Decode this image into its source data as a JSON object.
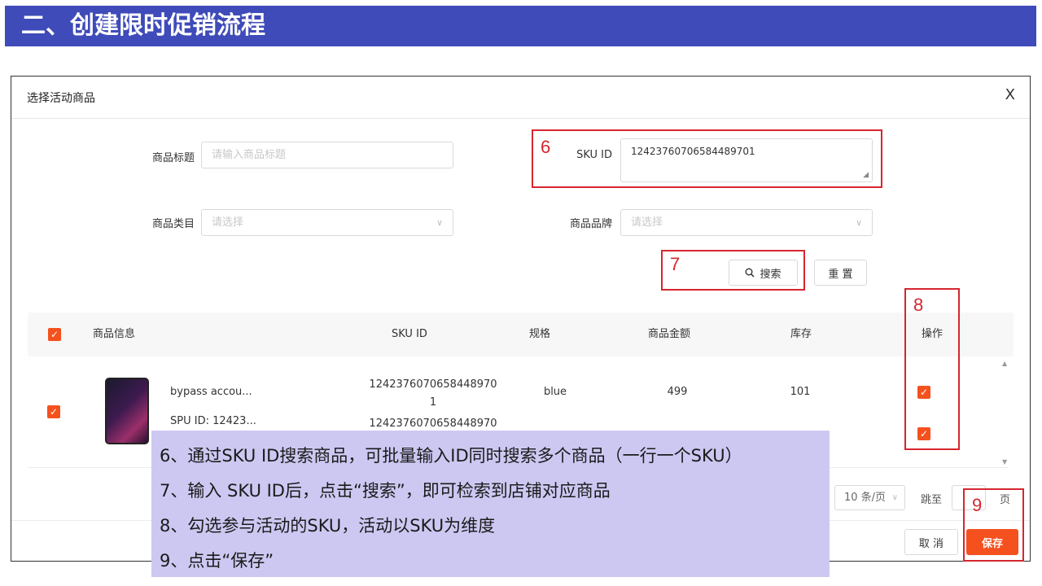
{
  "slide": {
    "title": "二、创建限时促销流程"
  },
  "dialog": {
    "title": "选择活动商品",
    "close": "X"
  },
  "form": {
    "title_label": "商品标题",
    "title_placeholder": "请输入商品标题",
    "sku_label": "SKU ID",
    "sku_value": "1242376070658448970​1",
    "category_label": "商品类目",
    "category_placeholder": "请选择",
    "brand_label": "商品品牌",
    "brand_placeholder": "请选择",
    "search_btn": "搜索",
    "reset_btn": "重 置"
  },
  "steps": {
    "s6": "6",
    "s7": "7",
    "s8": "8",
    "s9": "9"
  },
  "table": {
    "headers": {
      "product": "商品信息",
      "sku": "SKU ID",
      "spec": "规格",
      "price": "商品金额",
      "stock": "库存",
      "action": "操作"
    },
    "product": {
      "name": "bypass accou...",
      "spu": "SPU ID: 12423..."
    },
    "rows": [
      {
        "sku_line1": "1242376070658448970",
        "sku_line2": "1",
        "spec": "blue",
        "price": "499",
        "stock": "101"
      },
      {
        "sku_line1": "1242376070658448970",
        "sku_line2": "",
        "spec": "",
        "price": "",
        "stock": ""
      }
    ]
  },
  "pagination": {
    "page_size": "10 条/页",
    "jump_label": "跳至",
    "page_unit": "页"
  },
  "footer": {
    "cancel": "取 消",
    "save": "保存"
  },
  "notes": [
    "6、通过SKU ID搜索商品，可批量输入ID同时搜索多个商品（一行一个SKU）",
    "7、输入 SKU ID后，点击“搜索”，即可检索到店铺对应商品",
    "8、勾选参与活动的SKU，活动以SKU为维度",
    "9、点击“保存”"
  ],
  "colors": {
    "title_bar": "#3f4bb8",
    "accent": "#f4511e",
    "highlight": "#d6262f",
    "overlay": "#cdc8f2"
  }
}
